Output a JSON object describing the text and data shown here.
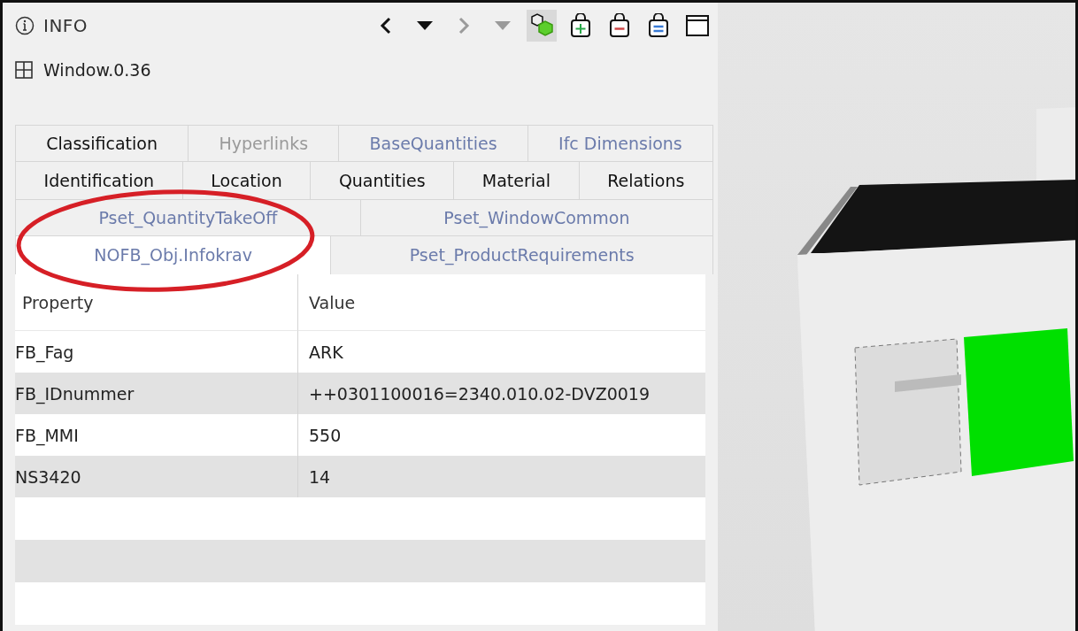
{
  "panel": {
    "title": "INFO"
  },
  "toolbar": [
    {
      "kind": "back",
      "disabled": false,
      "pressed": false
    },
    {
      "kind": "back-menu",
      "disabled": false,
      "pressed": false
    },
    {
      "kind": "forward",
      "disabled": true,
      "pressed": false
    },
    {
      "kind": "forward-menu",
      "disabled": true,
      "pressed": false
    },
    {
      "kind": "isolate",
      "disabled": false,
      "pressed": true
    },
    {
      "kind": "add",
      "disabled": false,
      "pressed": false
    },
    {
      "kind": "remove",
      "disabled": false,
      "pressed": false
    },
    {
      "kind": "equal",
      "disabled": false,
      "pressed": false
    },
    {
      "kind": "window",
      "disabled": false,
      "pressed": false
    }
  ],
  "object": {
    "name": "Window.0.36"
  },
  "tab_rows": [
    [
      {
        "label": "Classification",
        "kind": "attribute",
        "disabled": false,
        "selected": false
      },
      {
        "label": "Hyperlinks",
        "kind": "attribute",
        "disabled": true,
        "selected": false
      },
      {
        "label": "BaseQuantities",
        "kind": "pset",
        "disabled": false,
        "selected": false
      },
      {
        "label": "Ifc Dimensions",
        "kind": "pset",
        "disabled": false,
        "selected": false
      }
    ],
    [
      {
        "label": "Identification",
        "kind": "attribute",
        "disabled": false,
        "selected": false
      },
      {
        "label": "Location",
        "kind": "attribute",
        "disabled": false,
        "selected": false
      },
      {
        "label": "Quantities",
        "kind": "attribute",
        "disabled": false,
        "selected": false
      },
      {
        "label": "Material",
        "kind": "attribute",
        "disabled": false,
        "selected": false
      },
      {
        "label": "Relations",
        "kind": "attribute",
        "disabled": false,
        "selected": false
      }
    ],
    [
      {
        "label": "Pset_QuantityTakeOff",
        "kind": "pset",
        "disabled": false,
        "selected": false
      },
      {
        "label": "Pset_WindowCommon",
        "kind": "pset",
        "disabled": false,
        "selected": false
      }
    ],
    [
      {
        "label": "NOFB_Obj.Infokrav",
        "kind": "pset",
        "disabled": false,
        "selected": true
      },
      {
        "label": "Pset_ProductRequirements",
        "kind": "pset",
        "disabled": false,
        "selected": false
      }
    ]
  ],
  "table": {
    "columns": [
      "Property",
      "Value"
    ],
    "rows": [
      [
        "FB_Fag",
        "ARK"
      ],
      [
        "FB_IDnummer",
        "++0301100016=2340.010.02-DVZ0019"
      ],
      [
        "FB_MMI",
        "550"
      ],
      [
        "NS3420",
        "14"
      ]
    ]
  }
}
